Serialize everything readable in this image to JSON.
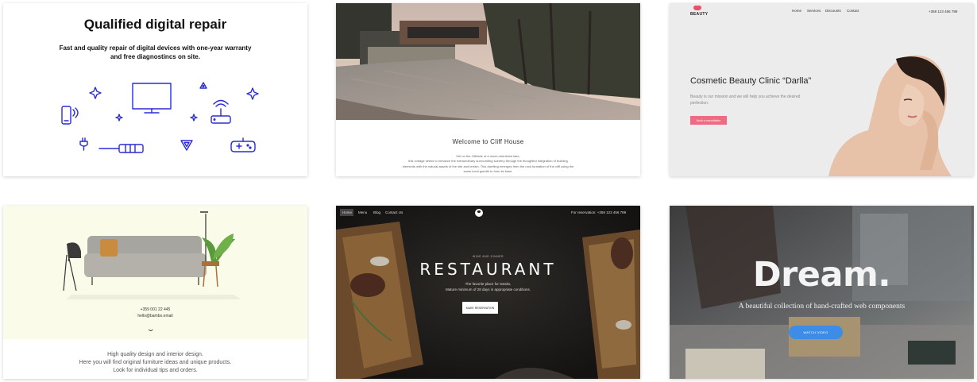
{
  "cards": {
    "repair": {
      "title": "Qualified digital repair",
      "subtitle_line1": "Fast and quality repair of digital devices with one-year warranty",
      "subtitle_line2": "and free diagnostincs on site.",
      "icons": [
        "phone-icon",
        "sparkle-icon",
        "monitor-icon",
        "triangle-icon",
        "router-icon",
        "plug-icon",
        "screwdriver-icon",
        "gamepad-icon"
      ],
      "accent": "#2b2bd6"
    },
    "cliff": {
      "title": "Welcome to Cliff House",
      "text_lines": [
        "Set on the Cliffside of a much-cherished lake,",
        "this cottage seeks to enhance the extraordinary surrounding scenery through the thoughtful integration of building",
        "elements with the natural assets of the site and terrain. This dwelling emerges from the rock formation of the cliff using the",
        "same local granite to form its base."
      ]
    },
    "beauty": {
      "logo": "BEAUTY",
      "nav": [
        "Home",
        "Services",
        "Discounts",
        "Contact"
      ],
      "phone": "+359 123 456 789",
      "title": "Cosmetic Beauty Clinic “Darlla”",
      "desc": "Beauty is our mission and we will help you achieve the desired perfection.",
      "button": "Book a consultation",
      "accent": "#ee6b82"
    },
    "furniture": {
      "phone": "+359 001 22 445",
      "email": "hello@bambo.email",
      "chevron": "⌄",
      "text_lines": [
        "High quality design and interior design.",
        "Here you will find original furniture ideas and unique products.",
        "Look for individual tips and orders."
      ]
    },
    "restaurant": {
      "nav": [
        "Home",
        "Menu",
        "Blog",
        "Contact Us"
      ],
      "reservation": "For reservation: +359 123 456 789",
      "small": "WINE AND DINNER",
      "title": "RESTAURANT",
      "desc_line1": "The favorite place for steaks,",
      "desc_line2": "Mature minimum of 28 days in appropriate conditions.",
      "button": "MAKE RESERVATION"
    },
    "dream": {
      "title": "Dream.",
      "desc": "A beautiful collection of hand-crafted web components",
      "button": "WATCH VIDEO",
      "accent": "#3d8de6"
    }
  }
}
